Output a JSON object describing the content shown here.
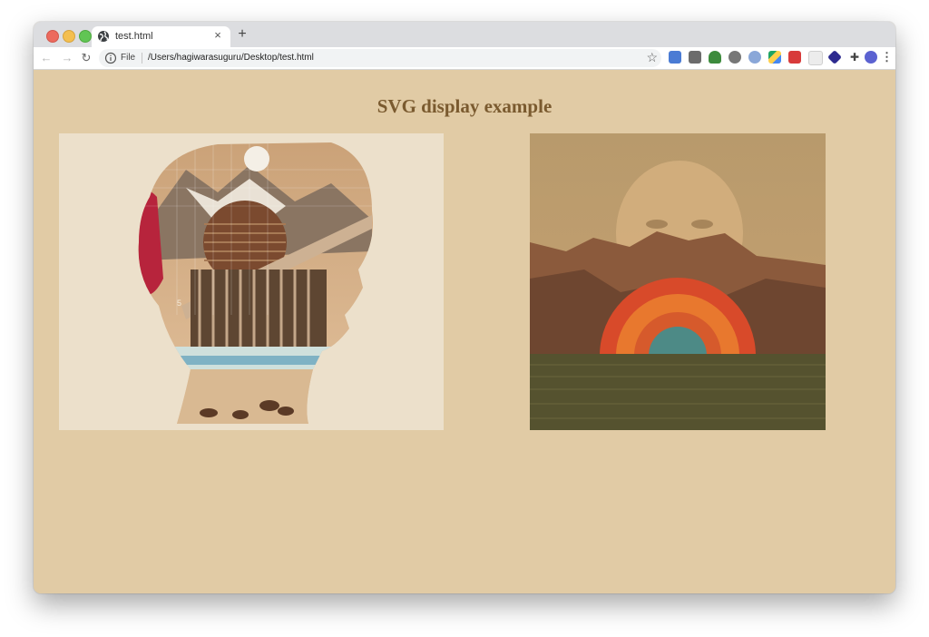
{
  "browser": {
    "tab_title": "test.html",
    "tab_close": "×",
    "new_tab": "+",
    "address": {
      "scheme_label": "File",
      "url": "/Users/hagiwarasuguru/Desktop/test.html"
    },
    "extensions": [
      "translate-icon",
      "tag-icon",
      "plant-icon",
      "robot-icon",
      "circle-icon",
      "drive-icon",
      "docs-icon",
      "square-icon",
      "stack-icon",
      "puzzle-icon",
      "profile-avatar"
    ]
  },
  "page": {
    "heading": "SVG display example",
    "images": [
      {
        "name": "collage-head-silhouette",
        "alt": "Collage silhouette of a head with mountains, architecture and animals",
        "number": "5"
      },
      {
        "name": "collage-face-mountain-sunset",
        "alt": "Collage of a face over a mountain landscape with a sunset rainbow"
      }
    ]
  }
}
